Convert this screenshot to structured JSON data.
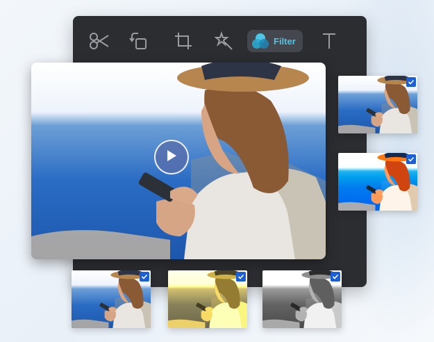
{
  "toolbar": {
    "tools": [
      {
        "icon": "scissors-icon"
      },
      {
        "icon": "rotate-icon"
      },
      {
        "icon": "crop-icon"
      },
      {
        "icon": "magic-wand-icon"
      },
      {
        "icon": "filter-icon",
        "label": "Filter",
        "active": true
      },
      {
        "icon": "text-icon"
      }
    ],
    "filter_label": "Filter",
    "accent_color": "#4fc6e8"
  },
  "preview": {
    "play_icon": "play-icon"
  },
  "thumbnails": [
    {
      "filter": "original",
      "checked": true
    },
    {
      "filter": "vivid-blue",
      "checked": true
    },
    {
      "filter": "original",
      "checked": true
    },
    {
      "filter": "warm-yellow",
      "checked": true
    },
    {
      "filter": "grayscale",
      "checked": true
    }
  ],
  "colors": {
    "panel_bg": "#2b2d31",
    "check_bg": "#1a5fd8"
  }
}
